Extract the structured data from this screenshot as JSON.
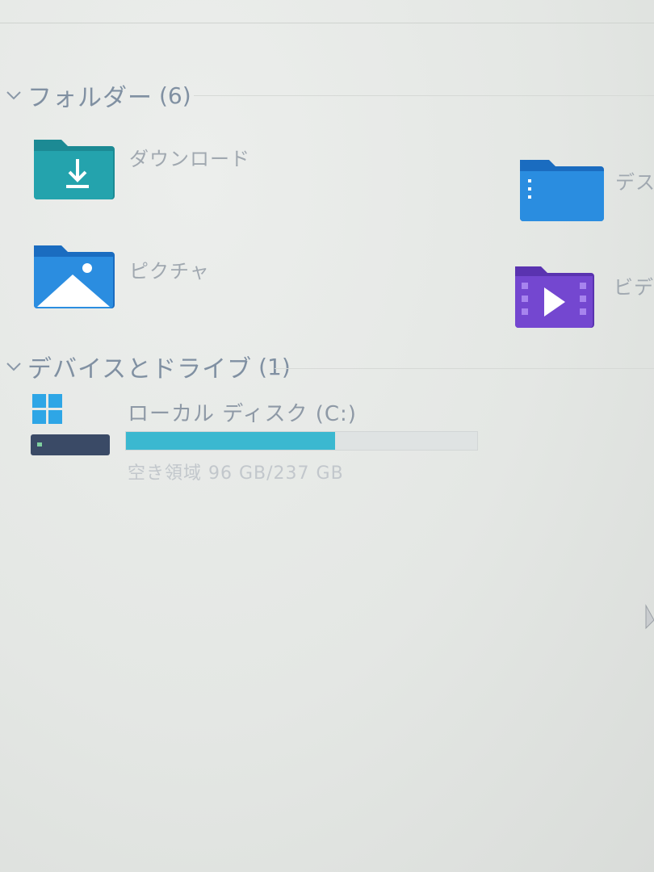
{
  "groups": {
    "folders": {
      "title": "フォルダー",
      "count": "(6)",
      "items": [
        {
          "label": "ダウンロード",
          "icon": "download-folder-icon"
        },
        {
          "label": "デス",
          "icon": "desktop-folder-icon"
        },
        {
          "label": "ピクチャ",
          "icon": "pictures-folder-icon"
        },
        {
          "label": "ビデオ",
          "icon": "videos-folder-icon"
        }
      ]
    },
    "devices": {
      "title": "デバイスとドライブ",
      "count": "(1)",
      "drive": {
        "name": "ローカル ディスク (C:)",
        "free_text": "空き領域 96 GB/237 GB",
        "used_fraction": 0.595,
        "icon": "windows-drive-icon"
      }
    }
  },
  "colors": {
    "accent_teal": "#1f8f98",
    "accent_blue": "#1f7ad0",
    "accent_purple": "#6a3fc4",
    "bar_fill": "#3bb8d0"
  }
}
